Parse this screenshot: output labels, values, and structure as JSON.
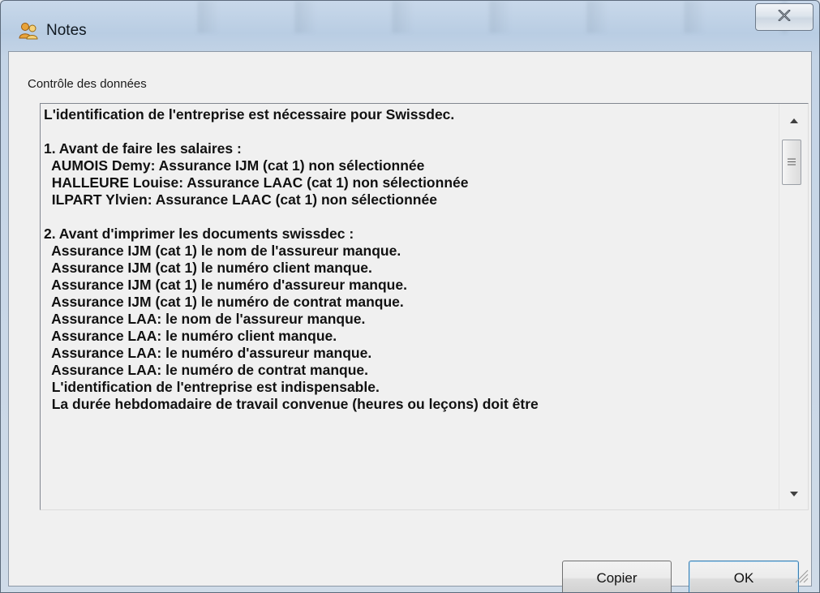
{
  "window": {
    "title": "Notes",
    "app_icon": "people-icon",
    "close_icon": "close-icon"
  },
  "group": {
    "label": "Contrôle des données"
  },
  "textbox": {
    "lines": [
      "L'identification de l'entreprise est nécessaire pour Swissdec.",
      "",
      "1. Avant de faire les salaires :",
      "  AUMOIS Demy: Assurance IJM (cat 1) non sélectionnée",
      "  HALLEURE Louise: Assurance LAAC (cat 1) non sélectionnée",
      "  ILPART Ylvien: Assurance LAAC (cat 1) non sélectionnée",
      "",
      "2. Avant d'imprimer les documents swissdec :",
      "  Assurance IJM (cat 1) le nom de l'assureur manque.",
      "  Assurance IJM (cat 1) le numéro client manque.",
      "  Assurance IJM (cat 1) le numéro d'assureur manque.",
      "  Assurance IJM (cat 1) le numéro de contrat manque.",
      "  Assurance LAA: le nom de l'assureur manque.",
      "  Assurance LAA: le numéro client manque.",
      "  Assurance LAA: le numéro d'assureur manque.",
      "  Assurance LAA: le numéro de contrat manque.",
      "  L'identification de l'entreprise est indispensable.",
      "  La durée hebdomadaire de travail convenue (heures ou leçons) doit être"
    ]
  },
  "buttons": {
    "copy_label": "Copier",
    "ok_label": "OK"
  }
}
